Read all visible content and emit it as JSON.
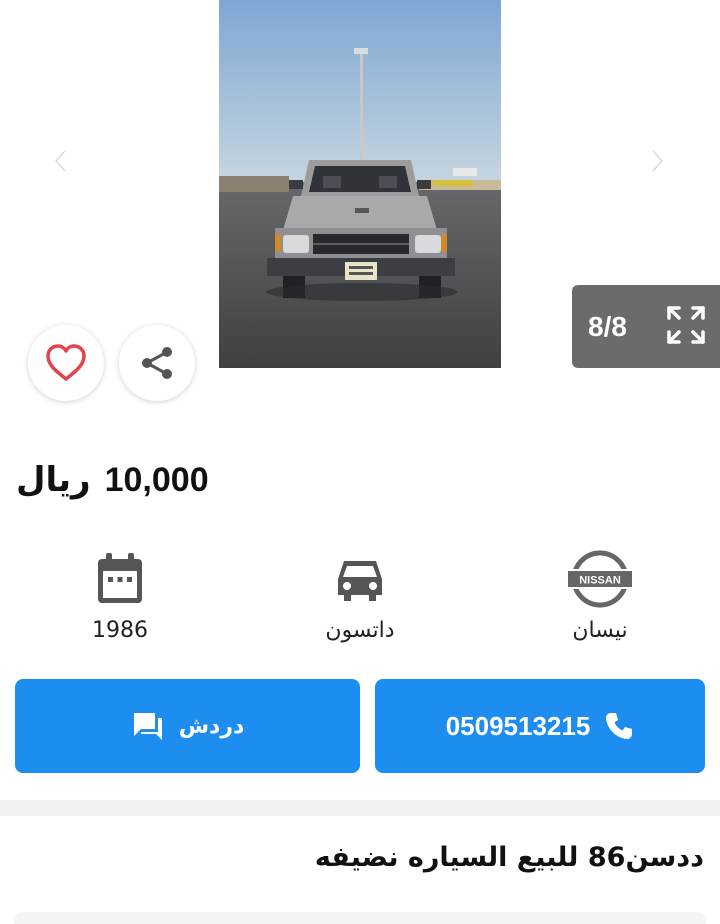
{
  "gallery": {
    "counter": "8/8",
    "icons": {
      "prev": "chevron-left-icon",
      "next": "chevron-right-icon",
      "expand": "expand-icon",
      "favorite": "heart-icon",
      "share": "share-icon"
    }
  },
  "price": {
    "amount": "10,000",
    "currency": "ريال"
  },
  "specs": {
    "year": {
      "label": "1986",
      "icon": "calendar-icon"
    },
    "model": {
      "label": "داتسون",
      "icon": "car-icon"
    },
    "make": {
      "label": "نيسان",
      "icon": "nissan-logo",
      "logo_text": "NISSAN"
    }
  },
  "actions": {
    "call": {
      "label": "0509513215",
      "icon": "phone-icon"
    },
    "chat": {
      "label": "دردش",
      "icon": "chat-icon"
    }
  },
  "listing": {
    "title": "ددسن86 للبيع السياره نضيفه"
  },
  "colors": {
    "accent": "#1e8df0",
    "favorite": "#e0454b",
    "counter_bg": "#6b6b6b"
  }
}
